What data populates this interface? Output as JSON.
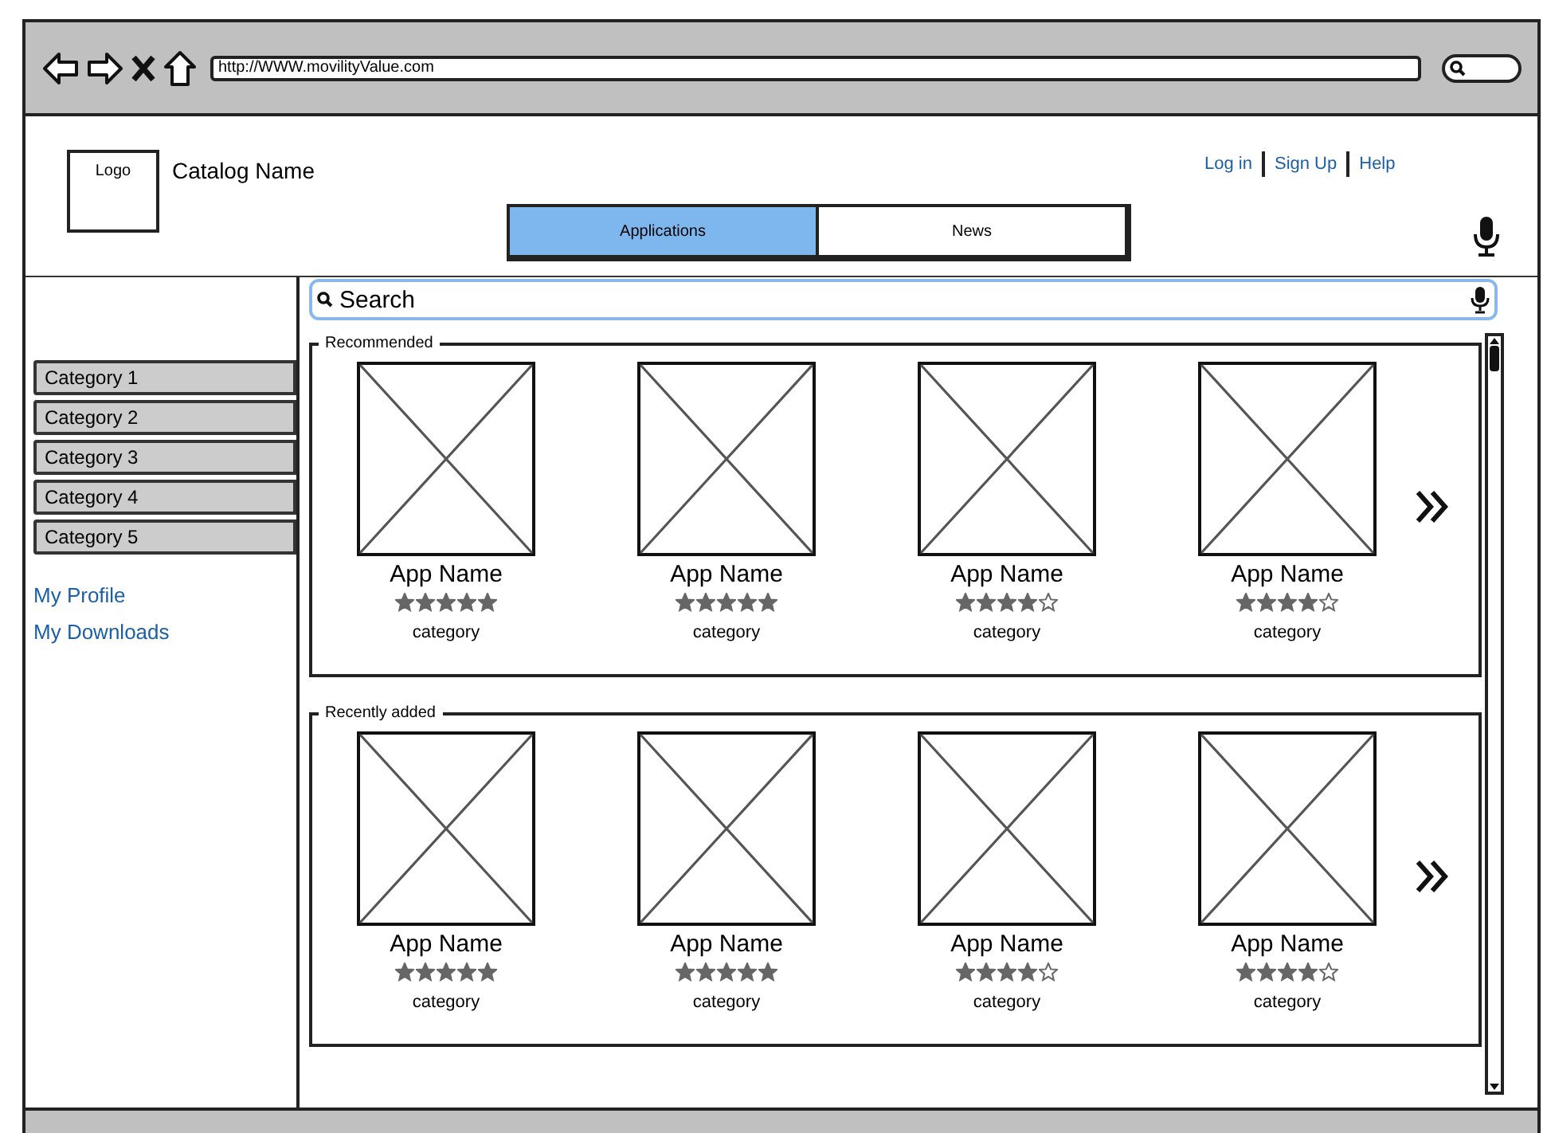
{
  "browser": {
    "url": "http://WWW.movilityValue.com"
  },
  "header": {
    "logo": "Logo",
    "catalog_name": "Catalog Name",
    "links": [
      "Log in",
      "Sign Up",
      "Help"
    ]
  },
  "tabs": [
    {
      "label": "Applications",
      "selected": true
    },
    {
      "label": "News",
      "selected": false
    }
  ],
  "search": {
    "placeholder": "Search"
  },
  "sidebar": {
    "categories": [
      "Category 1",
      "Category 2",
      "Category 3",
      "Category 4",
      "Category 5"
    ],
    "links": [
      "My Profile",
      "My Downloads"
    ]
  },
  "sections": [
    {
      "title": "Recommended",
      "apps": [
        {
          "name": "App Name",
          "stars": 5,
          "category": "category"
        },
        {
          "name": "App Name",
          "stars": 5,
          "category": "category"
        },
        {
          "name": "App Name",
          "stars": 4,
          "category": "category"
        },
        {
          "name": "App Name",
          "stars": 4,
          "category": "category"
        }
      ]
    },
    {
      "title": "Recently added",
      "apps": [
        {
          "name": "App Name",
          "stars": 5,
          "category": "category"
        },
        {
          "name": "App Name",
          "stars": 5,
          "category": "category"
        },
        {
          "name": "App Name",
          "stars": 4,
          "category": "category"
        },
        {
          "name": "App Name",
          "stars": 4,
          "category": "category"
        }
      ]
    }
  ]
}
